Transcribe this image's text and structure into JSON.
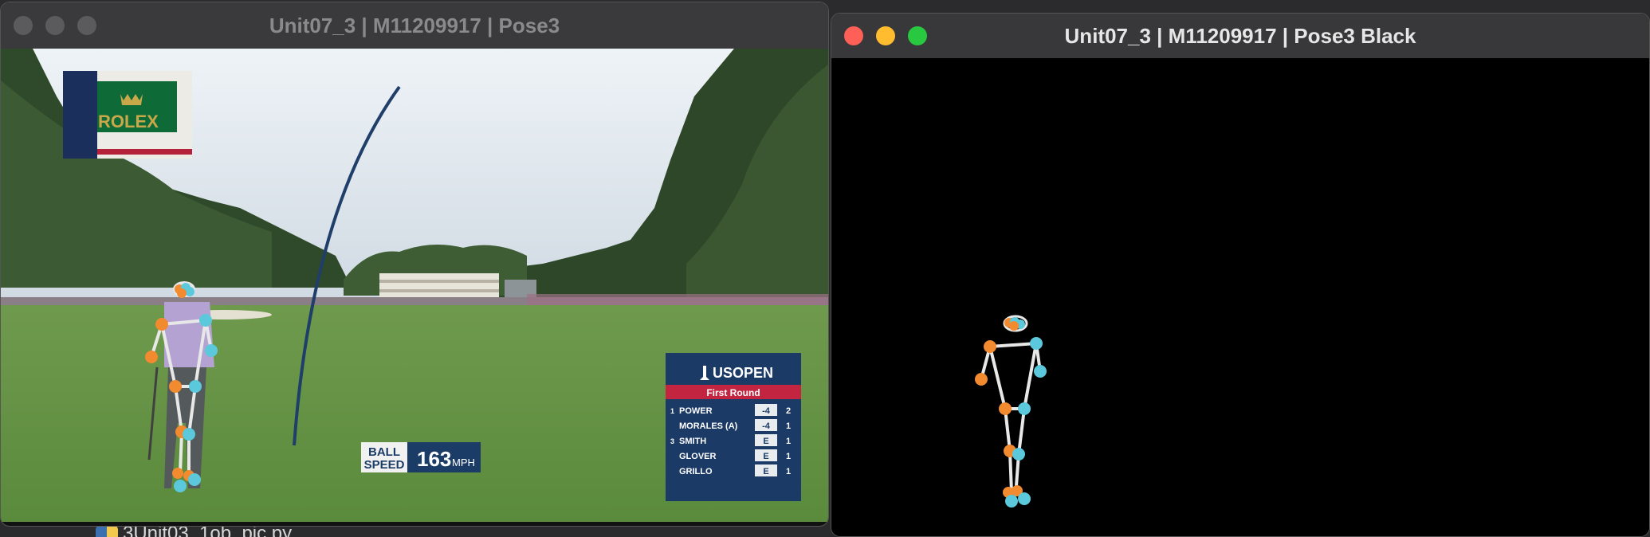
{
  "windows": {
    "left": {
      "title": "Unit07_3 | M11209917 | Pose3"
    },
    "right": {
      "title": "Unit07_3 | M11209917 | Pose3 Black"
    }
  },
  "background_file": {
    "name": "3Unit03_1ob_pic.py"
  },
  "broadcast": {
    "sponsor_logo": "ROLEX",
    "ball_speed": {
      "label_line1": "BALL",
      "label_line2": "SPEED",
      "value": "163",
      "unit": "MPH"
    },
    "leaderboard": {
      "event": "USOPEN",
      "round": "First Round",
      "rows": [
        {
          "pos": "1",
          "name": "POWER",
          "score": "-4",
          "thru": "2"
        },
        {
          "pos": "",
          "name": "MORALES (A)",
          "score": "-4",
          "thru": "1"
        },
        {
          "pos": "3",
          "name": "SMITH",
          "score": "E",
          "thru": "1"
        },
        {
          "pos": "",
          "name": "GLOVER",
          "score": "E",
          "thru": "1"
        },
        {
          "pos": "",
          "name": "GRILLO",
          "score": "E",
          "thru": "1"
        }
      ]
    }
  },
  "colors": {
    "keypoint_left": "#f28a30",
    "keypoint_right": "#5bc8dc",
    "skeleton": "#e8e8e8",
    "leaderboard_bg": "#1b3a66",
    "leaderboard_header": "#c3243f"
  }
}
